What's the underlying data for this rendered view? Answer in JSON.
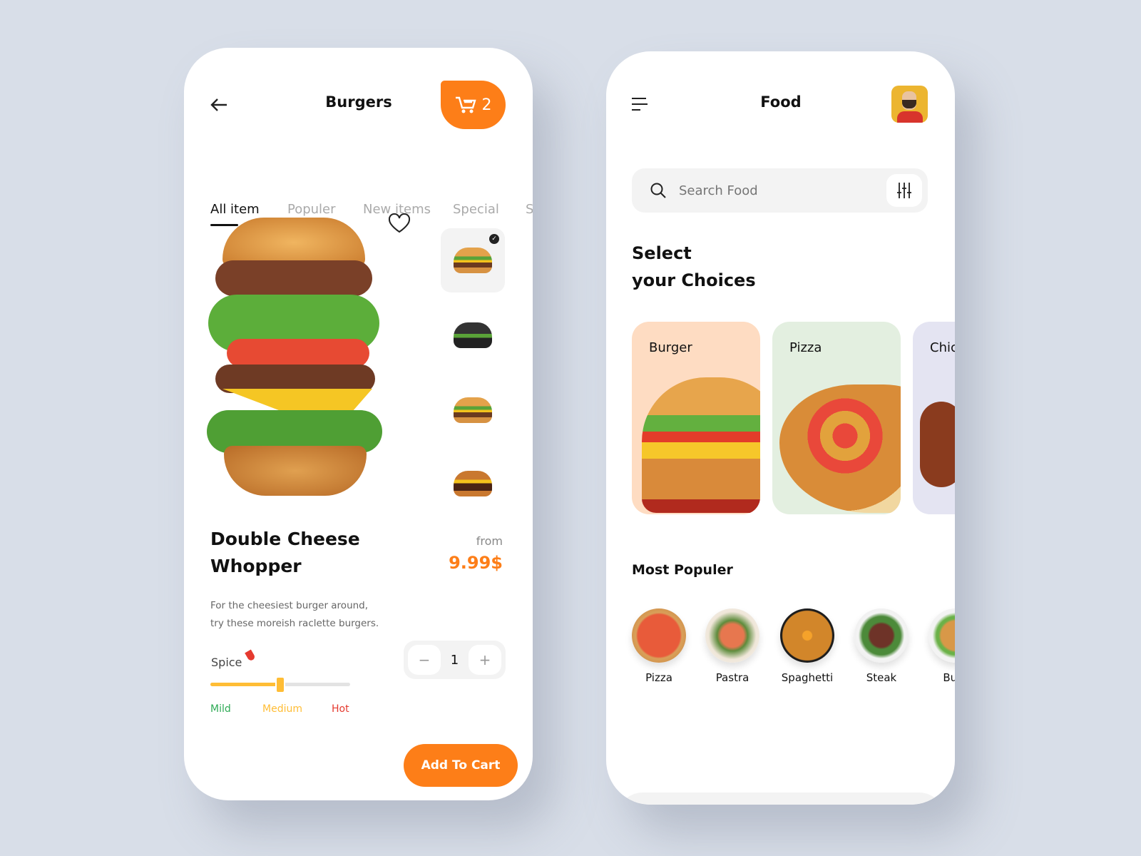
{
  "colors": {
    "accent": "#fd7e18",
    "mild": "#2eaa55",
    "medium": "#ffbd35",
    "hot": "#e53a2f",
    "background": "#d8dee8"
  },
  "detail": {
    "title": "Burgers",
    "cart_count": "2",
    "tabs": [
      "All item",
      "Populer",
      "New items",
      "Special",
      "S"
    ],
    "active_tab": "All item",
    "product_name_line1": "Double Cheese",
    "product_name_line2": "Whopper",
    "price_prefix": "from",
    "price": "9.99$",
    "description_line1": "For the cheesiest burger around,",
    "description_line2": "try these moreish raclette burgers.",
    "quantity": "1",
    "decrement": "−",
    "increment": "+",
    "spice_label": "Spice",
    "spice_levels": [
      "Mild",
      "Medium",
      "Hot"
    ],
    "spice_value": "Medium",
    "spice_percent": 50,
    "add_to_cart": "Add To Cart"
  },
  "home": {
    "title": "Food",
    "search_placeholder": "Search Food",
    "heading_line1": "Select",
    "heading_line2": "your Choices",
    "categories": [
      "Burger",
      "Pizza",
      "Chic"
    ],
    "popular_title": "Most Populer",
    "popular": [
      "Pizza",
      "Pastra",
      "Spaghetti",
      "Steak",
      "Burg"
    ],
    "nav": [
      "home-icon",
      "search-icon",
      "grid-icon",
      "bag-icon",
      "heart-icon"
    ],
    "active_nav": "grid-icon"
  }
}
